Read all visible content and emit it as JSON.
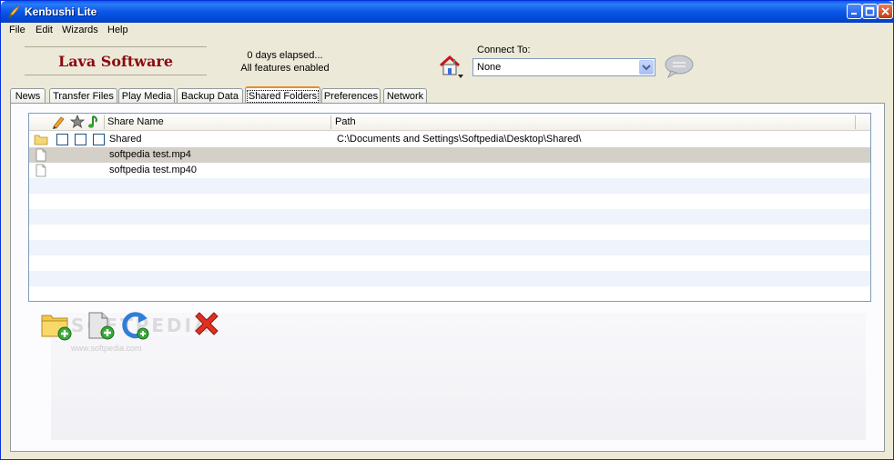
{
  "window": {
    "title": "Kenbushi Lite"
  },
  "menu": [
    "File",
    "Edit",
    "Wizards",
    "Help"
  ],
  "header": {
    "logo_text": "Lava Software",
    "status_elapsed": "0 days elapsed...",
    "status_features": "All features enabled",
    "connect_label": "Connect To:",
    "connect_value": "None"
  },
  "tabs": [
    "News",
    "Transfer Files",
    "Play Media",
    "Backup Data",
    "Shared Folders",
    "Preferences",
    "Network"
  ],
  "active_tab": "Shared Folders",
  "list": {
    "columns": {
      "share_name": "Share Name",
      "path": "Path"
    },
    "rows": [
      {
        "type": "folder",
        "name": "Shared",
        "path": "C:\\Documents and Settings\\Softpedia\\Desktop\\Shared\\"
      },
      {
        "type": "file",
        "name": "softpedia test.mp4",
        "path": ""
      },
      {
        "type": "file",
        "name": "softpedia test.mp40",
        "path": ""
      }
    ]
  },
  "watermark": {
    "text": "SOFTPEDIA",
    "url": "www.softpedia.com"
  },
  "icons": {
    "app": "flame-feather-icon",
    "home": "home-network-icon",
    "chat": "chat-bubble-icon",
    "col1": "pencil-icon",
    "col2": "star-badge-icon",
    "col3": "music-note-icon",
    "add_folder": "add-folder-icon",
    "add_file": "add-file-icon",
    "refresh": "refresh-icon",
    "delete": "delete-x-icon"
  },
  "colors": {
    "title_bar": "#0b57e6",
    "logo": "#8b0a12",
    "active_tab_accent": "#e68b2c",
    "delete": "#e03020"
  }
}
